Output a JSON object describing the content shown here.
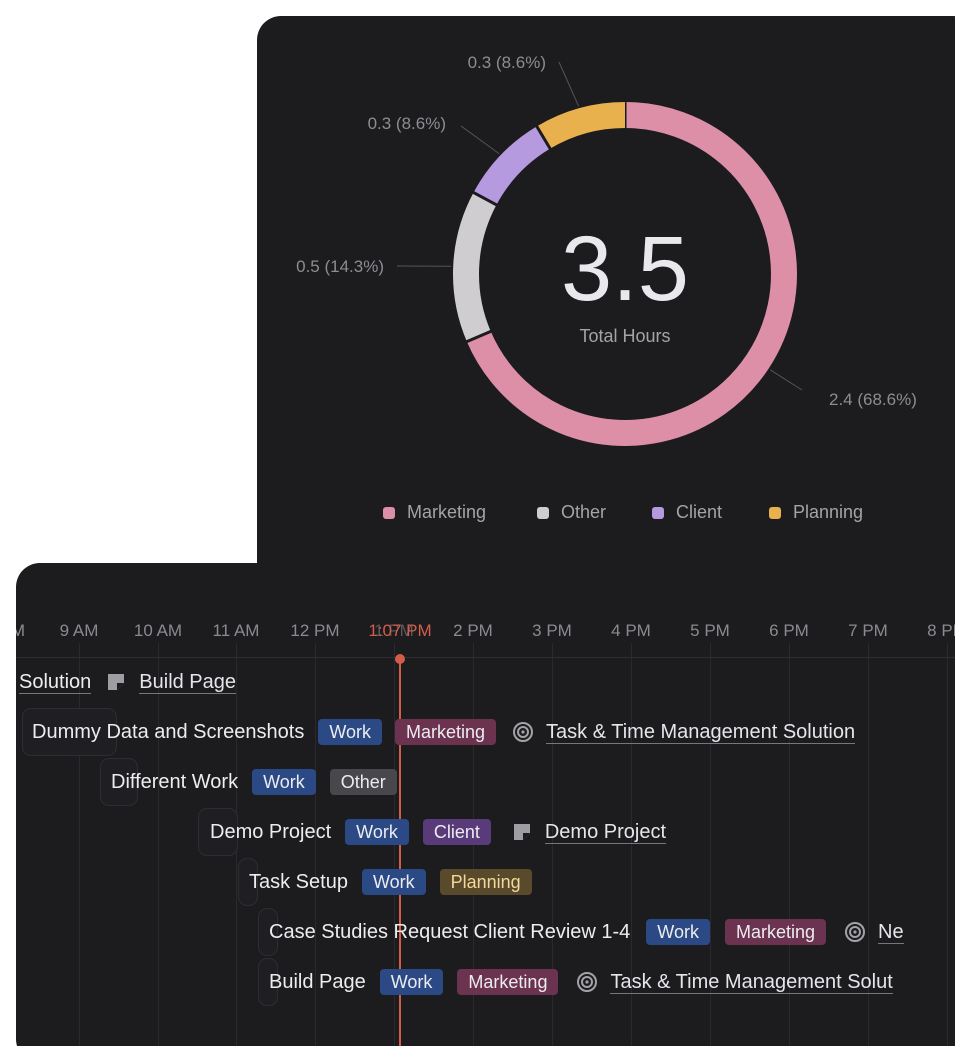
{
  "summary": {
    "total_value": "3.5",
    "total_label": "Total Hours"
  },
  "chart_data": {
    "type": "pie",
    "title": "",
    "total": 3.5,
    "series": [
      {
        "name": "Marketing",
        "value": 2.4,
        "percent": 68.6,
        "label": "2.4 (68.6%)",
        "color": "#dd8fa8"
      },
      {
        "name": "Other",
        "value": 0.5,
        "percent": 14.3,
        "label": "0.5 (14.3%)",
        "color": "#cfcdd0"
      },
      {
        "name": "Client",
        "value": 0.3,
        "percent": 8.6,
        "label": "0.3 (8.6%)",
        "color": "#b59ae0"
      },
      {
        "name": "Planning",
        "value": 0.3,
        "percent": 8.6,
        "label": "0.3 (8.6%)",
        "color": "#e9b14e"
      }
    ],
    "legend_position": "bottom"
  },
  "timeline": {
    "hours": [
      "M",
      "9 AM",
      "10 AM",
      "11 AM",
      "12 PM",
      "1 PM",
      "2 PM",
      "3 PM",
      "4 PM",
      "5 PM",
      "6 PM",
      "7 PM",
      "8 PM"
    ],
    "now_label": "1:07 PM",
    "rows": [
      {
        "title": "Solution",
        "link_icon": "page-icon",
        "link": "Build Page",
        "tags": []
      },
      {
        "title": "Dummy Data and Screenshots",
        "tags": [
          "Work",
          "Marketing"
        ],
        "link_icon": "target-icon",
        "link": "Task & Time Management Solution"
      },
      {
        "title": "Different Work",
        "tags": [
          "Work",
          "Other"
        ]
      },
      {
        "title": "Demo Project",
        "tags": [
          "Work",
          "Client"
        ],
        "link_icon": "page-icon",
        "link": "Demo Project"
      },
      {
        "title": "Task Setup",
        "tags": [
          "Work",
          "Planning"
        ]
      },
      {
        "title": "Case Studies Request Client Review 1-4",
        "tags": [
          "Work",
          "Marketing"
        ],
        "link_icon": "target-icon",
        "link": "Ne"
      },
      {
        "title": "Build Page",
        "tags": [
          "Work",
          "Marketing"
        ],
        "link_icon": "target-icon",
        "link": "Task & Time Management Solut"
      }
    ]
  }
}
